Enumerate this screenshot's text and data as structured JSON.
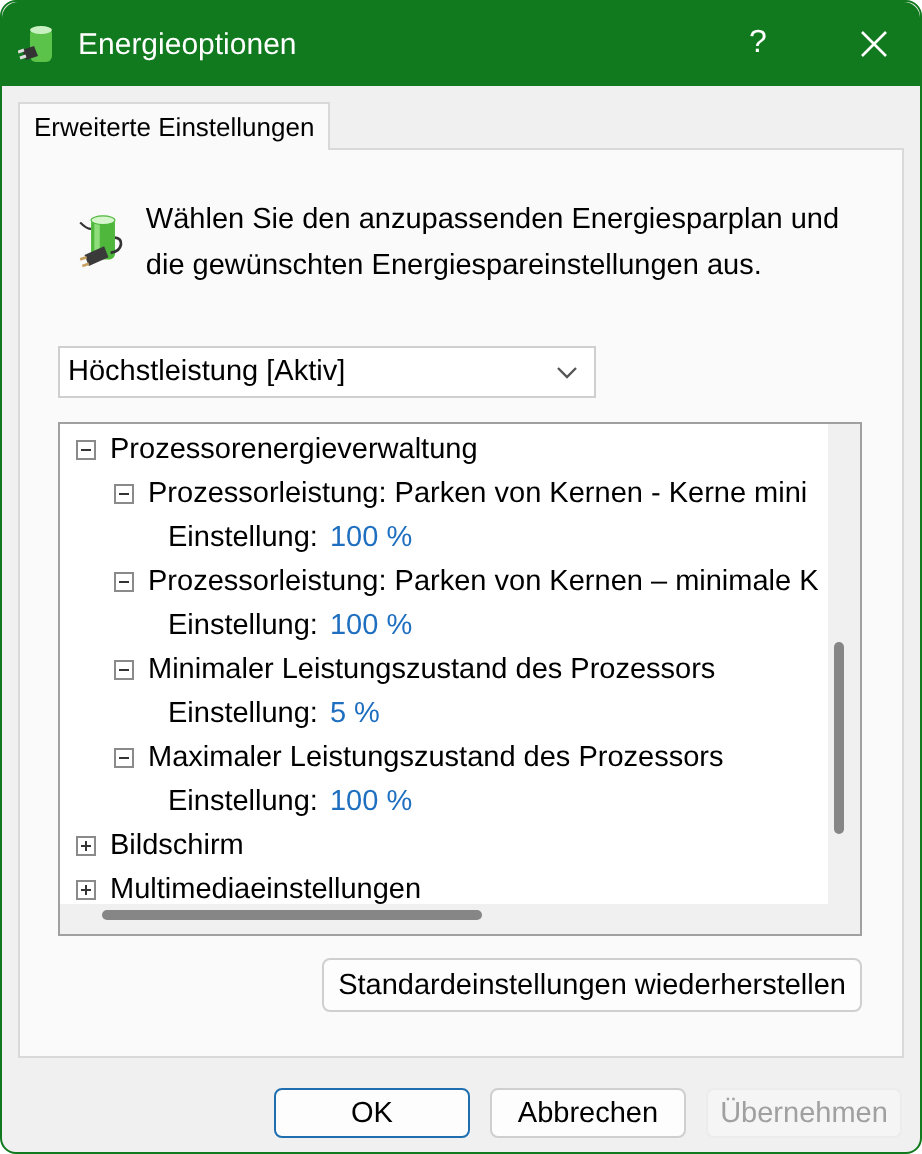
{
  "window": {
    "title": "Energieoptionen",
    "help": "?"
  },
  "tabs": [
    {
      "label": "Erweiterte Einstellungen",
      "selected": true
    }
  ],
  "intro": "Wählen Sie den anzupassenden Energiesparplan und die gewünschten Energiespareinstellungen aus.",
  "plan": {
    "value": "Höchstleistung [Aktiv]"
  },
  "tree": [
    {
      "kind": "group",
      "label": "Prozessorenergieverwaltung",
      "expanded": true,
      "children": [
        {
          "kind": "group",
          "label": "Prozessorleistung: Parken von Kernen - Kerne mini",
          "expanded": true,
          "children": [
            {
              "kind": "setting",
              "label": "Einstellung:",
              "value": "100 %"
            }
          ]
        },
        {
          "kind": "group",
          "label": "Prozessorleistung: Parken von Kernen – minimale K",
          "expanded": true,
          "children": [
            {
              "kind": "setting",
              "label": "Einstellung:",
              "value": "100 %"
            }
          ]
        },
        {
          "kind": "group",
          "label": "Minimaler Leistungszustand des Prozessors",
          "expanded": true,
          "children": [
            {
              "kind": "setting",
              "label": "Einstellung:",
              "value": "5 %"
            }
          ]
        },
        {
          "kind": "group",
          "label": "Maximaler Leistungszustand des Prozessors",
          "expanded": true,
          "children": [
            {
              "kind": "setting",
              "label": "Einstellung:",
              "value": "100 %"
            }
          ]
        }
      ]
    },
    {
      "kind": "group",
      "label": "Bildschirm",
      "expanded": false
    },
    {
      "kind": "group",
      "label": "Multimediaeinstellungen",
      "expanded": false
    }
  ],
  "restore_button": "Standardeinstellungen wiederherstellen",
  "buttons": [
    {
      "label": "OK",
      "default": true,
      "disabled": false
    },
    {
      "label": "Abbrechen",
      "default": false,
      "disabled": false
    },
    {
      "label": "Übernehmen",
      "default": false,
      "disabled": true
    }
  ]
}
